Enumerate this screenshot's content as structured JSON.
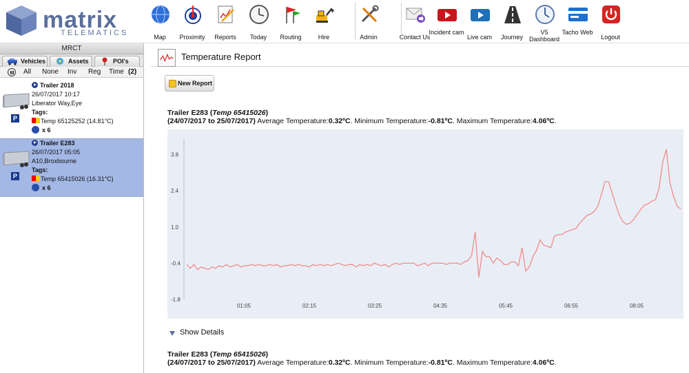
{
  "logo": {
    "word": "matrix",
    "sub": "TELEMATICS"
  },
  "nav": [
    {
      "label": "Map",
      "icon": "globe-icon"
    },
    {
      "label": "Proximity",
      "icon": "target-icon"
    },
    {
      "label": "Reports",
      "icon": "reports-icon"
    },
    {
      "label": "Today",
      "icon": "clock-icon"
    },
    {
      "label": "Routing",
      "icon": "flags-icon"
    },
    {
      "label": "Hire",
      "icon": "digger-icon"
    },
    {
      "label": "Admin",
      "icon": "tools-icon"
    },
    {
      "label": "Contact Us",
      "icon": "envelope-icon"
    },
    {
      "label": "Incident cam",
      "icon": "red-camera-icon"
    },
    {
      "label": "Live cam",
      "icon": "blue-camera-icon"
    },
    {
      "label": "Journey",
      "icon": "road-icon"
    },
    {
      "label": "V5 Dashboard",
      "icon": "gauge-icon"
    },
    {
      "label": "Tacho Web",
      "icon": "card-icon"
    },
    {
      "label": "Logout",
      "icon": "power-icon"
    }
  ],
  "sidebar": {
    "title": "MRCT",
    "tabs": [
      "Vehicles",
      "Assets",
      "POI's"
    ],
    "filters": [
      "All",
      "None",
      "Inv",
      "Reg",
      "Time"
    ],
    "filter_count": "(2)",
    "vehicles": [
      {
        "name": "Trailer 2018",
        "datetime": "26/07/2017 10:17",
        "location": "Liberator Way,Eye",
        "tags_label": "Tags:",
        "temp": "Temp 65125252 (14.81°C)",
        "count": "x 6",
        "park": "P",
        "selected": false
      },
      {
        "name": "Trailer E283",
        "datetime": "26/07/2017 05:05",
        "location": "A10,Broxbourne",
        "tags_label": "Tags:",
        "temp": "Temp 65415026 (16.31°C)",
        "count": "x 6",
        "park": "P",
        "selected": true
      }
    ]
  },
  "report": {
    "title": "Temperature Report",
    "new_report_label": "New Report",
    "show_details_label": "Show Details",
    "summary": {
      "trailer": "Trailer E283",
      "sensor": "Temp 65415026",
      "range": "(24/07/2017 to 25/07/2017)",
      "avg_label": "Average Temperature:",
      "avg": "0.32ºC",
      "min_label": "Minimum Temperature:",
      "min": "-0.81ºC",
      "max_label": "Maximum Temperature:",
      "max": "4.06ºC"
    }
  },
  "colors": {
    "line": "#f08b8b",
    "plot_bg": "#e9eef6",
    "selected_row": "#a4b8e6",
    "logo": "#5b6f9c"
  },
  "chart_data": {
    "type": "line",
    "title": "",
    "xlabel": "",
    "ylabel": "",
    "x_ticks": [
      "01:05",
      "02:15",
      "03:25",
      "04:35",
      "05:45",
      "06:55",
      "08:05"
    ],
    "y_ticks": [
      3.8,
      2.4,
      1.0,
      -0.4,
      -1.8
    ],
    "ylim": [
      -1.8,
      4.4
    ],
    "series": [
      {
        "values": [
          -0.45,
          -0.6,
          -0.45,
          -0.65,
          -0.55,
          -0.6,
          -0.65,
          -0.55,
          -0.6,
          -0.5,
          -0.55,
          -0.45,
          -0.55,
          -0.5,
          -0.45,
          -0.55,
          -0.5,
          -0.5,
          -0.45,
          -0.5,
          -0.45,
          -0.5,
          -0.5,
          -0.45,
          -0.5,
          -0.45,
          -0.55,
          -0.5,
          -0.5,
          -0.45,
          -0.5,
          -0.45,
          -0.5,
          -0.5,
          -0.55,
          -0.45,
          -0.5,
          -0.45,
          -0.5,
          -0.45,
          -0.5,
          -0.45,
          -0.4,
          -0.45,
          -0.5,
          -0.45,
          -0.45,
          -0.55,
          -0.45,
          -0.5,
          -0.45,
          -0.5,
          -0.4,
          -0.45,
          -0.5,
          -0.45,
          -0.55,
          -0.45,
          -0.4,
          -0.45,
          -0.4,
          -0.4,
          -0.4,
          -0.4,
          -0.5,
          -0.45,
          -0.4,
          -0.5,
          -0.4,
          -0.4,
          -0.4,
          -0.4,
          -0.45,
          -0.4,
          -0.4,
          -0.4,
          -0.45,
          -0.35,
          -0.3,
          -0.1,
          0.8,
          -0.95,
          0.05,
          -0.15,
          -0.15,
          -0.4,
          -0.2,
          -0.3,
          -0.45,
          -0.45,
          -0.35,
          -0.35,
          -0.5,
          0.2,
          -0.7,
          -0.55,
          -0.15,
          0.1,
          0.5,
          0.3,
          0.25,
          0.2,
          0.65,
          0.7,
          0.7,
          0.8,
          0.85,
          0.9,
          0.95,
          1.15,
          1.3,
          1.45,
          1.5,
          1.6,
          1.8,
          2.25,
          2.75,
          2.75,
          2.3,
          1.85,
          1.45,
          1.2,
          1.1,
          1.15,
          1.3,
          1.5,
          1.7,
          1.85,
          1.9,
          2.0,
          2.05,
          2.5,
          3.5,
          4.0,
          2.7,
          2.2,
          1.8,
          1.7
        ]
      }
    ]
  }
}
